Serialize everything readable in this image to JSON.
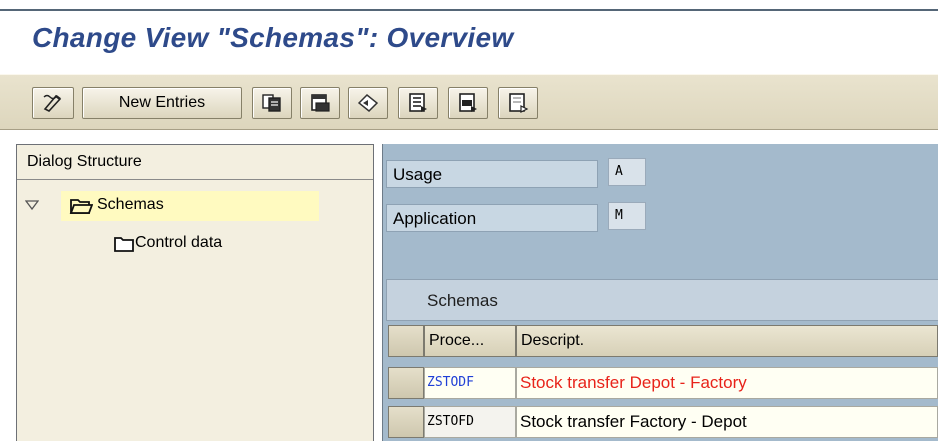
{
  "window": {
    "title": "Change View \"Schemas\": Overview"
  },
  "toolbar": {
    "new_entries_label": "New Entries",
    "icons": [
      "change-display-icon",
      "copy-icon",
      "delete-icon",
      "undo-icon",
      "select-all-icon",
      "select-block-icon",
      "deselect-all-icon"
    ]
  },
  "dialog_structure": {
    "title": "Dialog Structure",
    "items": [
      {
        "label": "Schemas",
        "icon": "open-folder-icon",
        "selected": true,
        "expanded": true
      },
      {
        "label": "Control data",
        "icon": "folder-icon",
        "selected": false
      }
    ]
  },
  "fields": {
    "usage": {
      "label": "Usage",
      "value": "A"
    },
    "application": {
      "label": "Application",
      "value": "M"
    }
  },
  "table": {
    "title": "Schemas",
    "columns": [
      "Proce...",
      "Descript."
    ],
    "rows": [
      {
        "procedure": "ZSTODF",
        "description": "Stock transfer Depot - Factory",
        "highlight": true
      },
      {
        "procedure": "ZSTOFD",
        "description": "Stock transfer Factory - Depot",
        "highlight": false
      }
    ]
  },
  "colors": {
    "title": "#2e4a8a",
    "highlight_code": "#1f3fd6",
    "highlight_desc": "#e8231a",
    "right_panel": "#a4bacc",
    "tree_selected": "#fffac0"
  }
}
